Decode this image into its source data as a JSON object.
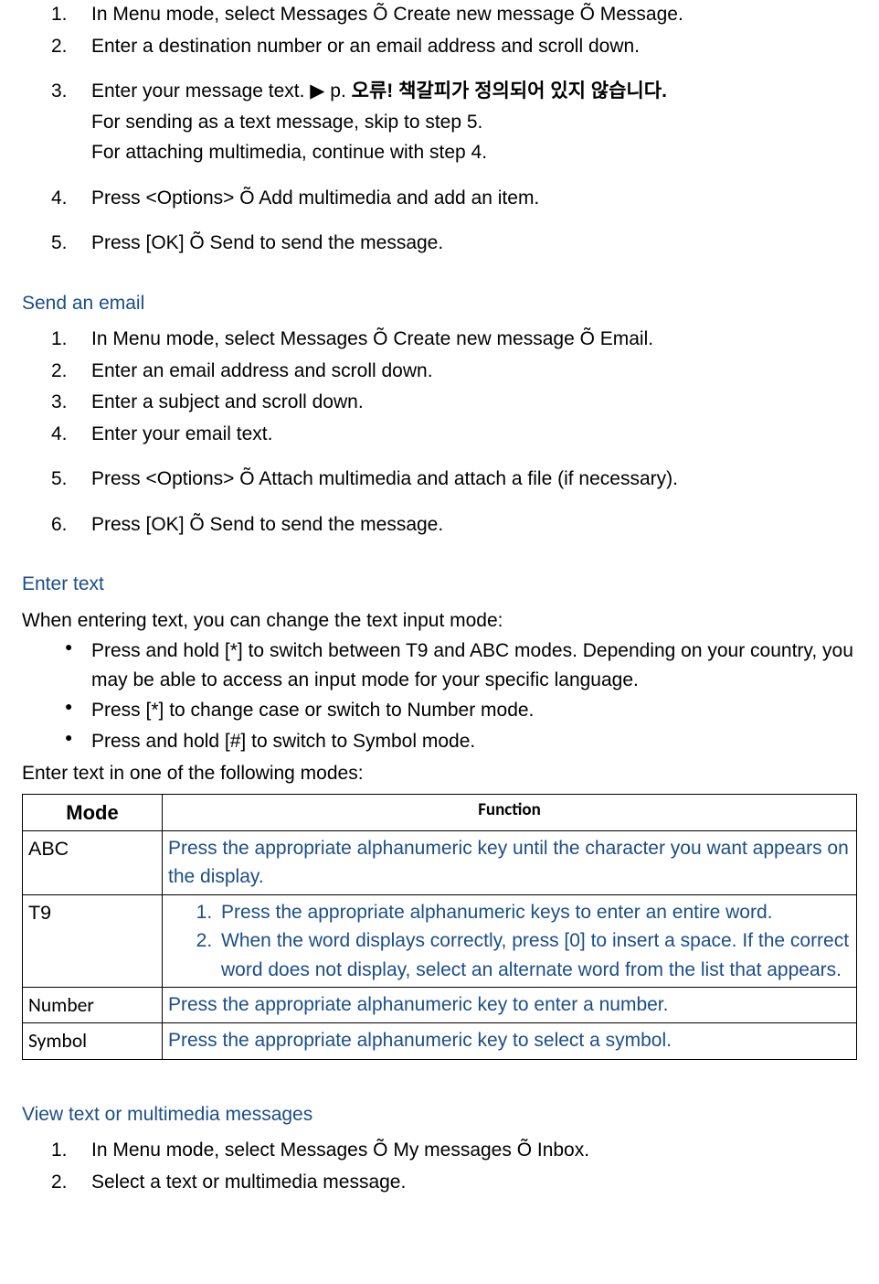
{
  "section1": {
    "items": [
      {
        "n": "1.",
        "text": "In Menu mode, select Messages Õ Create new message Õ Message."
      },
      {
        "n": "2.",
        "text": "Enter a destination number or an email address and scroll down."
      },
      {
        "n": "3.",
        "pre": "Enter your message text. ",
        "tri": "▶",
        "post": " p.  ",
        "err": "오류!  책갈피가  정의되어  있지  않습니다.",
        "sub1": "For sending as a text message, skip to step 5.",
        "sub2": "For attaching multimedia, continue with step 4."
      },
      {
        "n": "4.",
        "text": "Press <Options> Õ Add multimedia and add an item."
      },
      {
        "n": "5.",
        "text": "Press [OK] Õ Send to send the message."
      }
    ]
  },
  "section2": {
    "heading": "Send an email",
    "items": [
      {
        "n": "1.",
        "text": "In Menu mode, select Messages Õ Create new message Õ Email."
      },
      {
        "n": "2.",
        "text": "Enter an email address and scroll down."
      },
      {
        "n": "3.",
        "text": "Enter a subject and scroll down."
      },
      {
        "n": "4.",
        "text": "Enter your email text."
      },
      {
        "n": "5.",
        "text": "Press <Options> Õ Attach multimedia and attach a file (if necessary)."
      },
      {
        "n": "6.",
        "text": "Press [OK] Õ Send to send the message."
      }
    ]
  },
  "section3": {
    "heading": "Enter text",
    "intro": "When entering text, you can change the text input mode:",
    "bullets": [
      "Press and hold [*] to switch between T9 and ABC modes. Depending on your country, you may be able to access an input mode for your specific language.",
      "Press [*] to change case or switch to Number mode.",
      "Press and hold [#] to switch to Symbol mode."
    ],
    "intro2": "Enter text in one of the following modes:",
    "table": {
      "headers": {
        "mode": "Mode",
        "func": "Function"
      },
      "rows": {
        "abc": {
          "mode": "ABC",
          "func": "Press the appropriate alphanumeric key until the character you want appears on the display."
        },
        "t9": {
          "mode": "T9",
          "s1n": "1.",
          "s1": "Press the appropriate alphanumeric keys to enter an entire word.",
          "s2n": "2.",
          "s2": "When the word displays correctly, press [0] to insert a space. If the correct word does not display, select an alternate word from the list that appears."
        },
        "number": {
          "mode": "Number",
          "func": "Press the appropriate alphanumeric key to enter a number."
        },
        "symbol": {
          "mode": "Symbol",
          "func": "Press the appropriate alphanumeric key to select a symbol."
        }
      }
    }
  },
  "section4": {
    "heading": "View text or multimedia messages",
    "items": [
      {
        "n": "1.",
        "text": "In Menu mode, select Messages Õ My messages Õ Inbox."
      },
      {
        "n": "2.",
        "text": "Select a text or multimedia message."
      }
    ]
  }
}
